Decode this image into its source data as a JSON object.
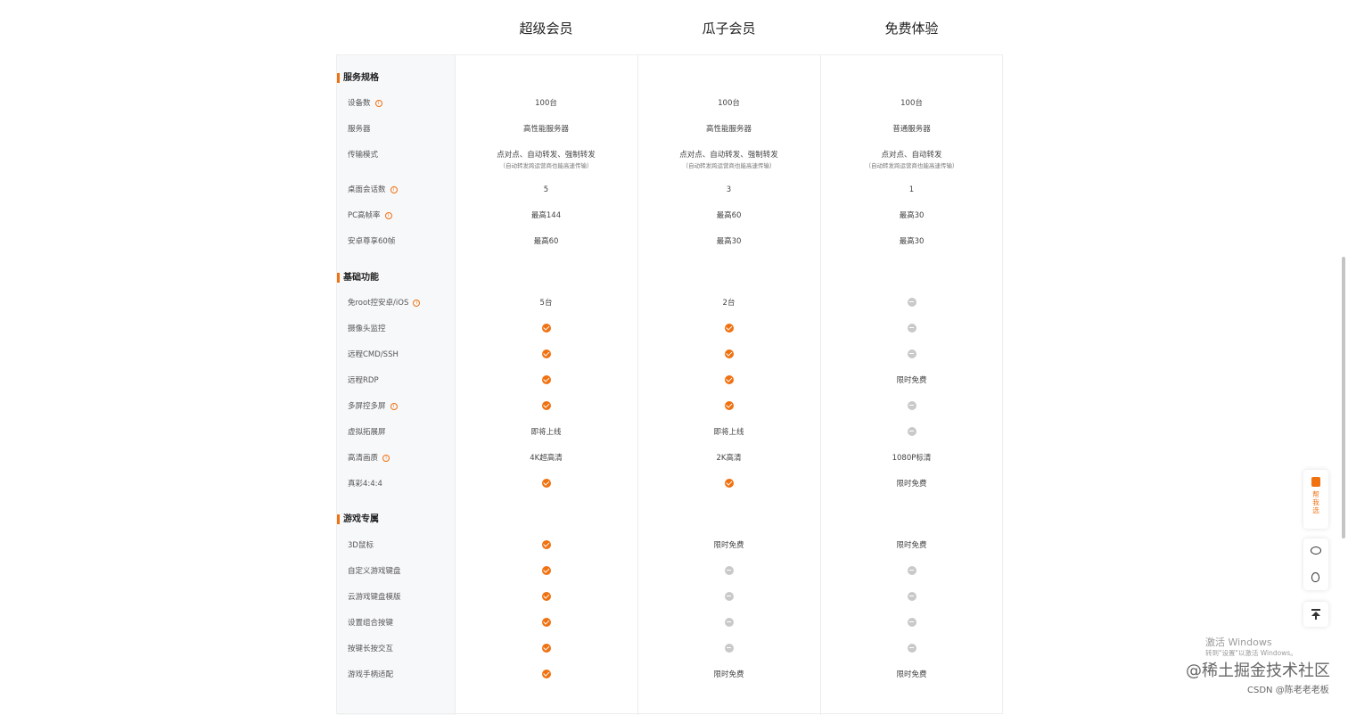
{
  "plans": [
    "超级会员",
    "瓜子会员",
    "免费体验"
  ],
  "colors": {
    "accent": "#f07110",
    "unavailable": "#c9c9c9"
  },
  "sections": [
    {
      "title": "服务规格",
      "rows": [
        {
          "label": "设备数",
          "info": true,
          "values": [
            "100台",
            "100台",
            "100台"
          ]
        },
        {
          "label": "服务器",
          "info": false,
          "values": [
            "高性能服务器",
            "高性能服务器",
            "普通服务器"
          ]
        },
        {
          "label": "传输模式",
          "info": false,
          "values": [
            "点对点、自动转发、强制转发",
            "点对点、自动转发、强制转发",
            "点对点、自动转发"
          ],
          "subs": [
            "（自动转发跨运营商也能高速传输）",
            "（自动转发跨运营商也能高速传输）",
            "（自动转发跨运营商也能高速传输）"
          ]
        },
        {
          "label": "桌面会话数",
          "info": true,
          "values": [
            "5",
            "3",
            "1"
          ]
        },
        {
          "label": "PC高帧率",
          "info": true,
          "values": [
            "最高144",
            "最高60",
            "最高30"
          ]
        },
        {
          "label": "安卓尊享60帧",
          "info": false,
          "values": [
            "最高60",
            "最高30",
            "最高30"
          ]
        }
      ]
    },
    {
      "title": "基础功能",
      "rows": [
        {
          "label": "免root控安卓/iOS",
          "info": true,
          "values": [
            "5台",
            "2台",
            "@dash"
          ]
        },
        {
          "label": "摄像头监控",
          "info": false,
          "values": [
            "@check",
            "@check",
            "@dash"
          ]
        },
        {
          "label": "远程CMD/SSH",
          "info": false,
          "values": [
            "@check",
            "@check",
            "@dash"
          ]
        },
        {
          "label": "远程RDP",
          "info": false,
          "values": [
            "@check",
            "@check",
            "限时免费"
          ]
        },
        {
          "label": "多屏控多屏",
          "info": true,
          "values": [
            "@check",
            "@check",
            "@dash"
          ]
        },
        {
          "label": "虚拟拓展屏",
          "info": false,
          "values": [
            "即将上线",
            "即将上线",
            "@dash"
          ]
        },
        {
          "label": "高清画质",
          "info": true,
          "values": [
            "4K超高清",
            "2K高清",
            "1080P标清"
          ]
        },
        {
          "label": "真彩4:4:4",
          "info": false,
          "values": [
            "@check",
            "@check",
            "限时免费"
          ]
        }
      ]
    },
    {
      "title": "游戏专属",
      "rows": [
        {
          "label": "3D鼠标",
          "info": false,
          "values": [
            "@check",
            "限时免费",
            "限时免费"
          ]
        },
        {
          "label": "自定义游戏键盘",
          "info": false,
          "values": [
            "@check",
            "@dash",
            "@dash"
          ]
        },
        {
          "label": "云游戏键盘模版",
          "info": false,
          "values": [
            "@check",
            "@dash",
            "@dash"
          ]
        },
        {
          "label": "设置组合按键",
          "info": false,
          "values": [
            "@check",
            "@dash",
            "@dash"
          ]
        },
        {
          "label": "按键长按交互",
          "info": false,
          "values": [
            "@check",
            "@dash",
            "@dash"
          ]
        },
        {
          "label": "游戏手柄适配",
          "info": false,
          "values": [
            "@check",
            "限时免费",
            "限时免费"
          ]
        }
      ]
    }
  ],
  "info_glyph": "i",
  "floating": {
    "help_text": "帮我选",
    "icons": [
      "help-doc-icon",
      "wechat-icon",
      "qq-icon",
      "back-to-top-icon"
    ]
  },
  "watermark": {
    "activate_title": "激活 Windows",
    "activate_sub": "转到\"设置\"以激活 Windows。",
    "juejin": "@稀土掘金技术社区",
    "csdn": "CSDN @陈老老老板"
  }
}
